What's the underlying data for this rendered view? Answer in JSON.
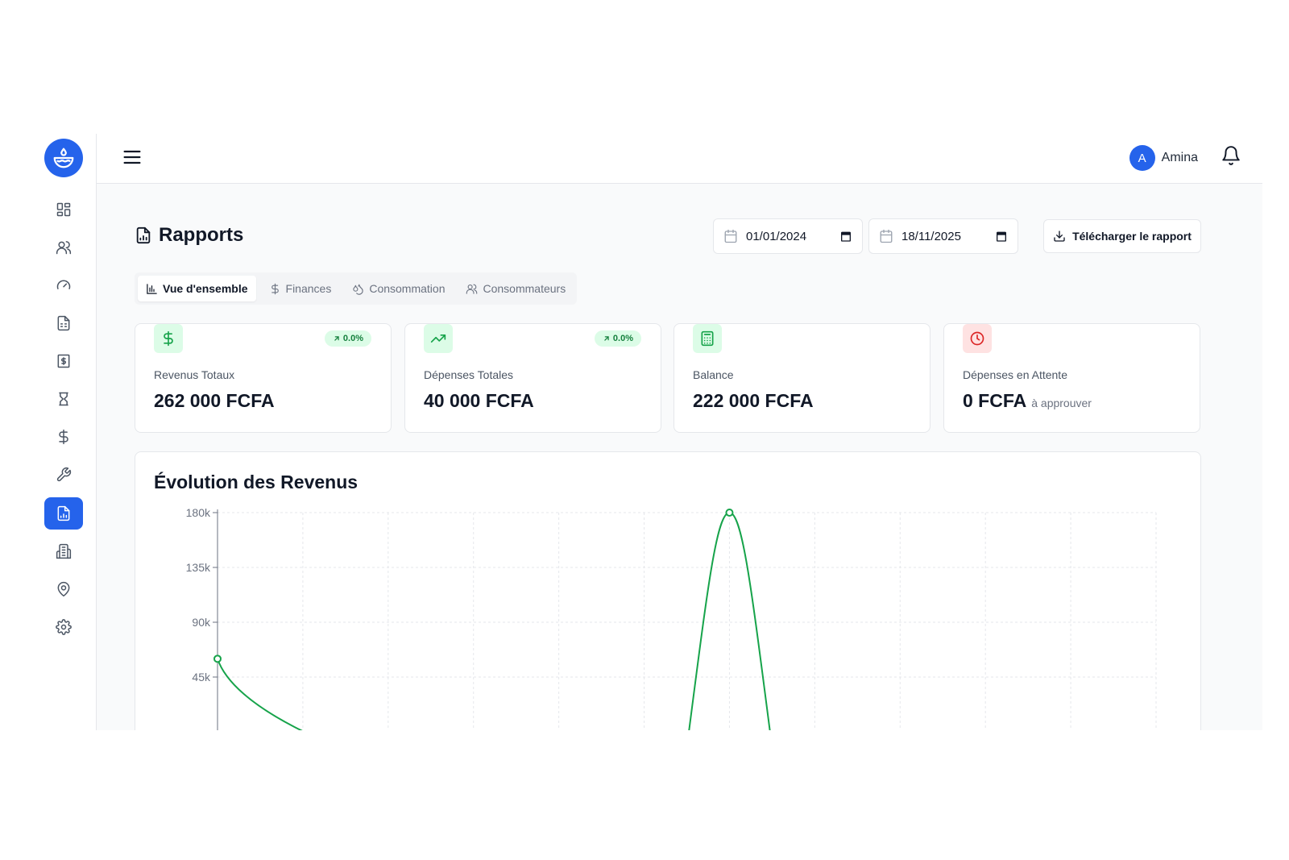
{
  "user": {
    "initial": "A",
    "name": "Amina"
  },
  "page": {
    "title": "Rapports"
  },
  "filters": {
    "start_date": "01/01/2024",
    "end_date": "18/11/2025",
    "download_label": "Télécharger le rapport"
  },
  "tabs": [
    {
      "label": "Vue d'ensemble",
      "icon": "bar-chart-icon",
      "active": true
    },
    {
      "label": "Finances",
      "icon": "dollar-icon",
      "active": false
    },
    {
      "label": "Consommation",
      "icon": "droplets-icon",
      "active": false
    },
    {
      "label": "Consommateurs",
      "icon": "users-icon",
      "active": false
    }
  ],
  "stats": [
    {
      "label": "Revenus Totaux",
      "value": "262 000 FCFA",
      "badge": "0.0%",
      "icon": "dollar-icon",
      "color": "#16a34a",
      "bg": "#dcfce7"
    },
    {
      "label": "Dépenses Totales",
      "value": "40 000 FCFA",
      "badge": "0.0%",
      "icon": "trending-up-icon",
      "color": "#16a34a",
      "bg": "#dcfce7"
    },
    {
      "label": "Balance",
      "value": "222 000 FCFA",
      "icon": "calculator-icon",
      "color": "#16a34a",
      "bg": "#dcfce7"
    },
    {
      "label": "Dépenses en Attente",
      "value": "0 FCFA",
      "note": "à approuver",
      "icon": "clock-icon",
      "color": "#dc2626",
      "bg": "#fee2e2"
    }
  ],
  "sidebar": {
    "items": [
      {
        "icon": "dashboard-icon",
        "active": false
      },
      {
        "icon": "users-icon",
        "active": false
      },
      {
        "icon": "gauge-icon",
        "active": false
      },
      {
        "icon": "file-text-icon",
        "active": false
      },
      {
        "icon": "receipt-dollar-icon",
        "active": false
      },
      {
        "icon": "hourglass-icon",
        "active": false
      },
      {
        "icon": "dollar-icon",
        "active": false
      },
      {
        "icon": "wrench-icon",
        "active": false
      },
      {
        "icon": "file-chart-icon",
        "active": true
      },
      {
        "icon": "building-icon",
        "active": false
      },
      {
        "icon": "map-pin-icon",
        "active": false
      },
      {
        "icon": "settings-icon",
        "active": false
      }
    ]
  },
  "chart": {
    "title": "Évolution des Revenus"
  },
  "chart_data": {
    "type": "line",
    "title": "Évolution des Revenus",
    "xlabel": "",
    "ylabel": "",
    "y_ticks": [
      45000,
      90000,
      135000,
      180000
    ],
    "y_tick_labels": [
      "45k",
      "90k",
      "135k",
      "180k"
    ],
    "ylim": [
      0,
      180000
    ],
    "grid": true,
    "series": [
      {
        "color": "#16a34a",
        "points": [
          {
            "x": 0,
            "y": 60000
          },
          {
            "x": 6,
            "y": 180000
          }
        ]
      }
    ],
    "x_count": 12
  }
}
